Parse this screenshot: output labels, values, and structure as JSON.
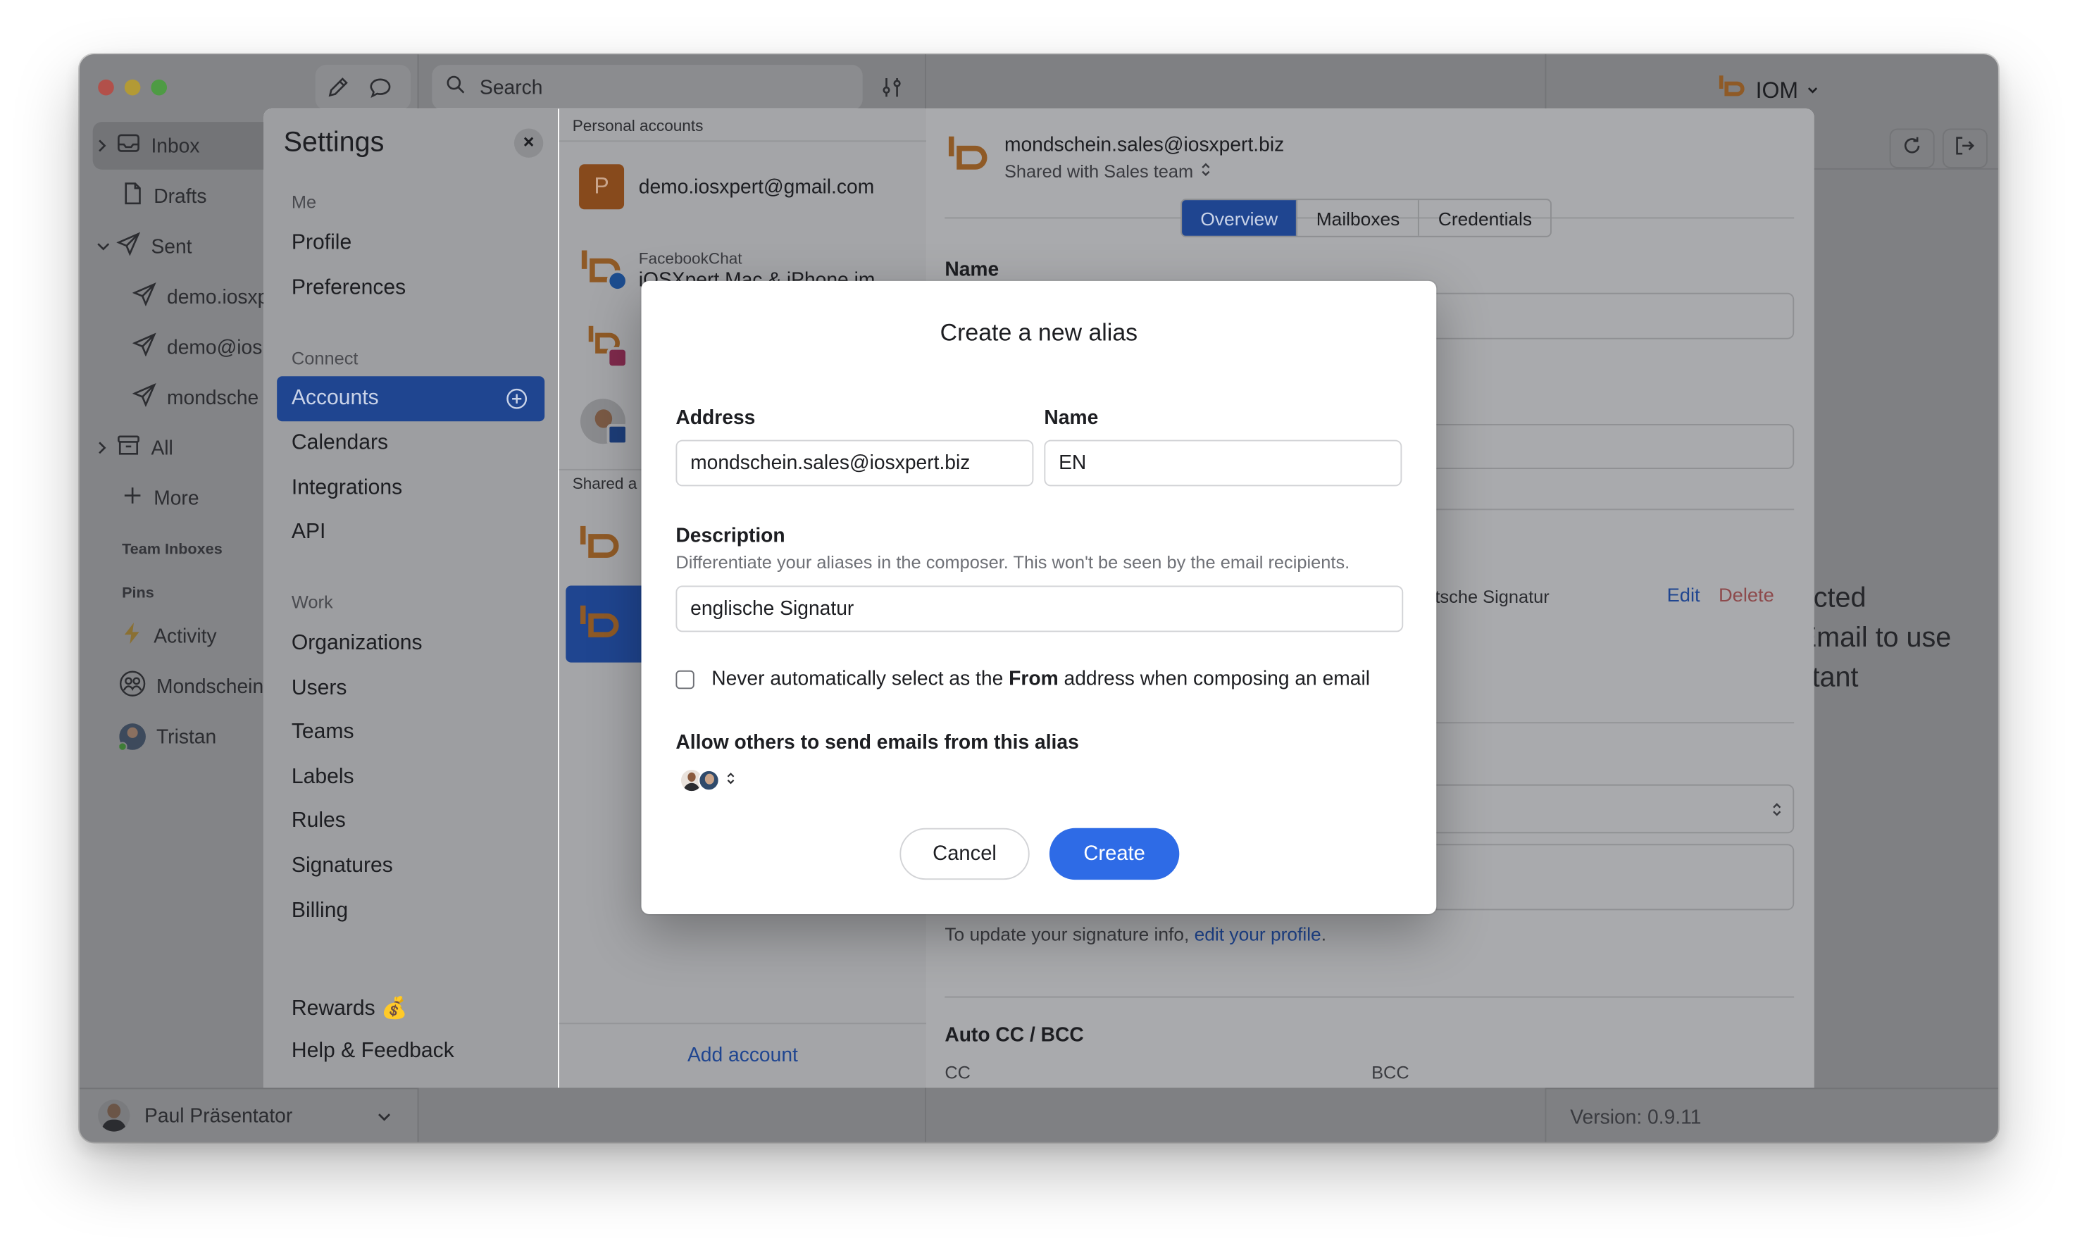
{
  "window": {
    "search_placeholder": "Search",
    "workspace": "IOM",
    "version": "Version: 0.9.11",
    "colors": {
      "close": "#b2504a",
      "minimize": "#b39a35",
      "zoom": "#4e9b44",
      "accent": "#2e6be6",
      "danger": "#e5484d",
      "brand_orange": "#d58b3b"
    }
  },
  "sidebar": {
    "items": [
      {
        "label": "Inbox",
        "icon": "inbox-icon"
      },
      {
        "label": "Drafts",
        "icon": "document-icon"
      },
      {
        "label": "Sent",
        "icon": "paper-plane-icon"
      },
      {
        "label": "demo.iosxp",
        "icon": "paper-plane-icon"
      },
      {
        "label": "demo@ios",
        "icon": "paper-plane-icon"
      },
      {
        "label": "mondsche",
        "icon": "paper-plane-icon"
      },
      {
        "label": "All",
        "icon": "archive-icon"
      },
      {
        "label": "More",
        "icon": "plus-icon"
      }
    ],
    "team_inboxes": "Team Inboxes",
    "pins": "Pins",
    "pinned": [
      {
        "label": "Activity",
        "icon": "lightning-icon"
      },
      {
        "label": "Mondschein",
        "icon": "group-icon"
      },
      {
        "label": "Tristan",
        "icon": "avatar"
      }
    ],
    "user": "Paul Präsentator"
  },
  "settings": {
    "title": "Settings",
    "sections": [
      {
        "heading": "Me",
        "items": [
          "Profile",
          "Preferences"
        ]
      },
      {
        "heading": "Connect",
        "items": [
          "Accounts",
          "Calendars",
          "Integrations",
          "API"
        ]
      },
      {
        "heading": "Work",
        "items": [
          "Organizations",
          "Users",
          "Teams",
          "Labels",
          "Rules",
          "Signatures",
          "Billing"
        ]
      }
    ],
    "footer_items": [
      "Rewards 💰",
      "Help & Feedback"
    ],
    "selected": "Accounts"
  },
  "accounts": {
    "personal_heading": "Personal accounts",
    "shared_heading": "Shared a",
    "personal": [
      {
        "name": "demo.iosxpert@gmail.com",
        "avatar_letter": "P"
      },
      {
        "service": "FacebookChat",
        "name": "iOSXpert Mac & iPhone im"
      }
    ],
    "add_account": "Add account"
  },
  "detail": {
    "email": "mondschein.sales@iosxpert.biz",
    "shared_with": "Shared with Sales team",
    "tabs": [
      "Overview",
      "Mailboxes",
      "Credentials"
    ],
    "active_tab": "Overview",
    "name_label": "Name",
    "alias_signature_partial": "tsche Signatur",
    "edit": "Edit",
    "delete": "Delete",
    "signature_note": "To update your signature info, ",
    "signature_link": "edit your profile",
    "auto_cc_heading": "Auto CC / BCC",
    "cc_label": "CC",
    "bcc_label": "BCC"
  },
  "background_text": {
    "line1": "ected",
    "line2": "Email to use",
    "line3": "stant"
  },
  "modal": {
    "title": "Create a new alias",
    "address_label": "Address",
    "address_value": "mondschein.sales@iosxpert.biz",
    "name_label": "Name",
    "name_value": "EN",
    "description_label": "Description",
    "description_help": "Differentiate your aliases in the composer. This won't be seen by the email recipients.",
    "description_value": "englische Signatur",
    "checkbox_before": "Never automatically select as the ",
    "checkbox_bold": "From",
    "checkbox_after": " address when composing an email",
    "checkbox_checked": false,
    "allow_label": "Allow others to send emails from this alias",
    "cancel": "Cancel",
    "create": "Create"
  }
}
